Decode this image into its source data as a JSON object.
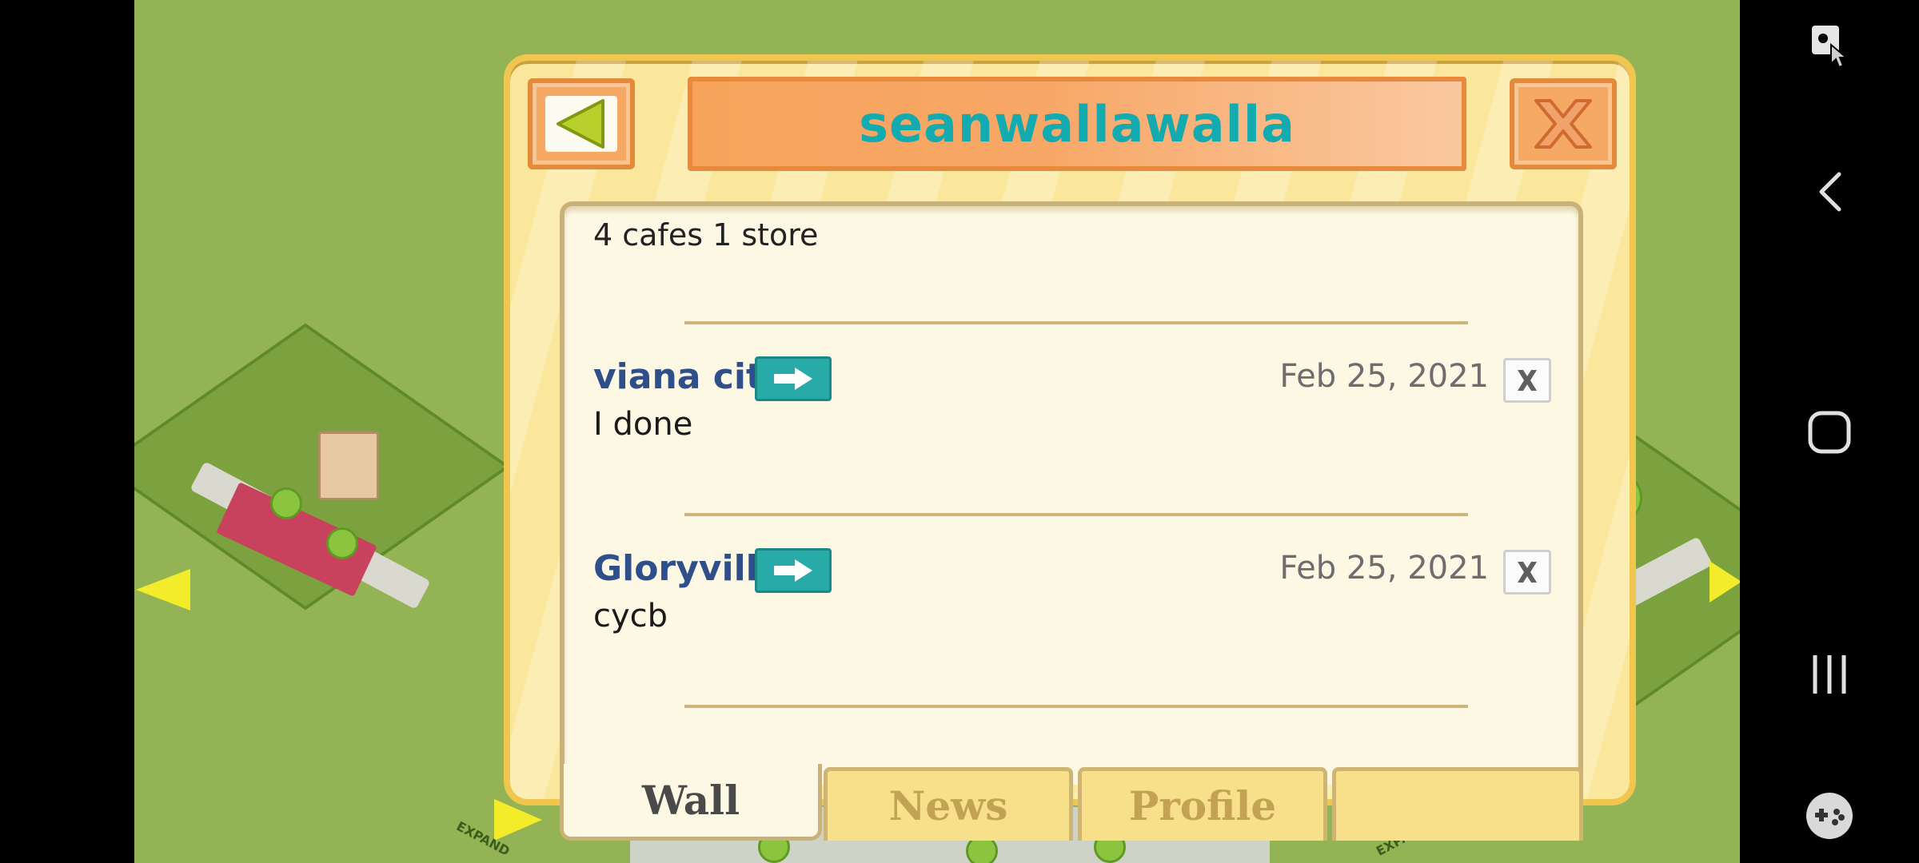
{
  "dialog": {
    "title": "seanwallawalla",
    "intro": "4 cafes 1 store",
    "posts": [
      {
        "author": "viana city",
        "date": "Feb 25, 2021",
        "message": "I done"
      },
      {
        "author": "Gloryville",
        "date": "Feb 25, 2021",
        "message": "cycb"
      }
    ],
    "tabs": [
      {
        "label": "Wall",
        "active": true
      },
      {
        "label": "News",
        "active": false
      },
      {
        "label": "Profile",
        "active": false
      },
      {
        "label": "",
        "active": false
      }
    ]
  },
  "map": {
    "expand_label": "EXPAND"
  },
  "colors": {
    "title": "#13aab0",
    "author": "#2f4f8a",
    "visit_button": "#27aaa8",
    "grass": "#93b354"
  },
  "icons": {
    "back": "back-arrow-icon",
    "close": "close-x-icon",
    "visit": "arrow-right-icon",
    "delete": "delete-x-icon",
    "screenshot": "screenshot-touch-icon",
    "nav_back": "chevron-left-icon",
    "home": "home-square-icon",
    "recents": "recents-bars-icon",
    "game_tools": "gamepad-icon"
  }
}
